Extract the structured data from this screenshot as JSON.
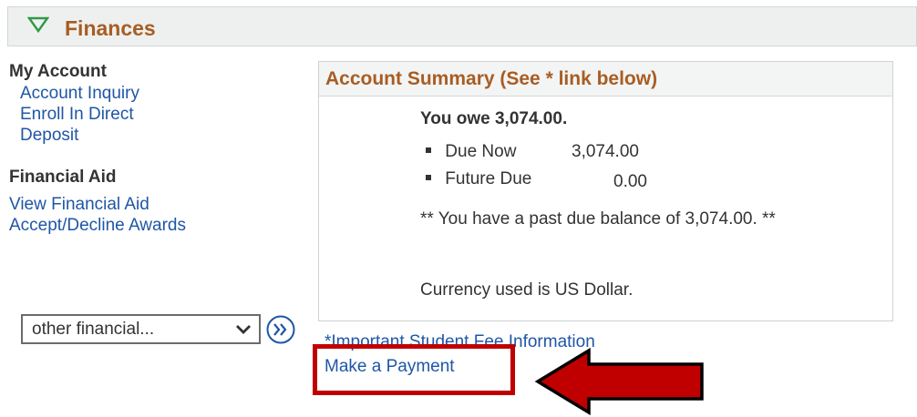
{
  "header": {
    "title": "Finances"
  },
  "left": {
    "my_account_title": "My Account",
    "my_account_links": [
      "Account Inquiry",
      "Enroll In Direct",
      "Deposit"
    ],
    "financial_aid_title": "Financial Aid",
    "financial_aid_links": [
      "View Financial Aid",
      "Accept/Decline Awards"
    ],
    "select_value": "other financial..."
  },
  "summary": {
    "title": "Account Summary (See * link below)",
    "owe_text": "You owe 3,074.00.",
    "rows": [
      {
        "label": "Due Now",
        "amount": "3,074.00"
      },
      {
        "label": "Future Due",
        "amount": "0.00"
      }
    ],
    "past_due_text": "** You have a past due balance of 3,074.00. **",
    "currency_text": "Currency used is US Dollar."
  },
  "links": {
    "fee_info": "*Important Student Fee Information",
    "make_payment": "Make a Payment"
  },
  "colors": {
    "header_text": "#a85d23",
    "link": "#1f56a5",
    "highlight": "#c00000",
    "triangle": "#2e9a44"
  },
  "icons": {
    "collapse": "triangle-down-icon",
    "dropdown": "chevron-down-icon",
    "go": "double-chevron-right-icon",
    "pointer": "arrow-left-icon"
  }
}
